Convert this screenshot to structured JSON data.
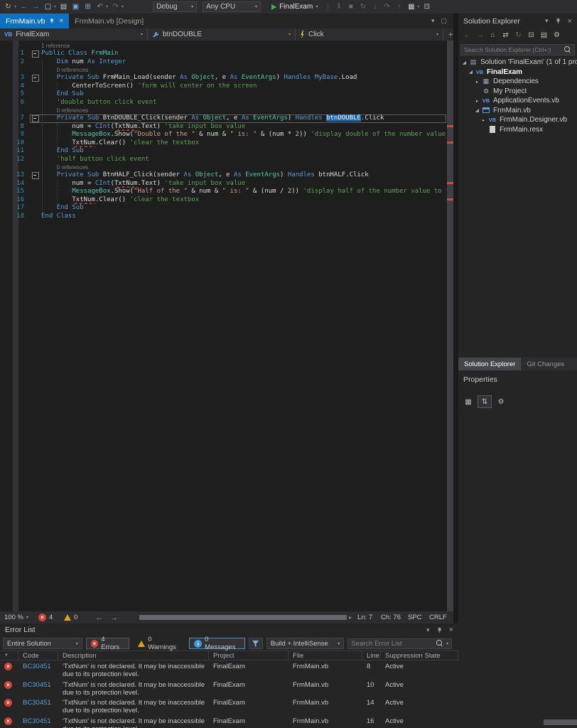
{
  "colors": {
    "accent_blue": "#0e70c0",
    "selection_blue": "#1c63b0",
    "error_red": "#d04437",
    "warning_yellow": "#d9a61a",
    "run_green": "#3cb63c",
    "keyword_blue": "#569cd6",
    "type_teal": "#4ec9b0",
    "string_orange": "#d69d85",
    "comment_green": "#57a64a",
    "line_number_teal": "#2b91af"
  },
  "top_toolbar": {
    "debug_combo": "Debug",
    "platform_combo": "Any CPU",
    "start_label": "FinalExam",
    "icons_left": [
      {
        "name": "hot-reload-icon",
        "glyph": "↻",
        "color": "#d8a657",
        "arrow": true
      },
      {
        "name": "nav-back-icon",
        "glyph": "←",
        "color": "#4b9fd6"
      },
      {
        "name": "nav-forward-icon",
        "glyph": "→",
        "color": "#4b9fd6"
      },
      {
        "name": "new-file-icon",
        "glyph": "▢",
        "color": "#c8c8c8",
        "arrow": true
      },
      {
        "name": "open-file-icon",
        "glyph": "▤",
        "color": "#c8c8c8"
      },
      {
        "name": "save-icon",
        "glyph": "▣",
        "color": "#7aa7d6"
      },
      {
        "name": "save-all-icon",
        "glyph": "⊞",
        "color": "#7aa7d6"
      },
      {
        "name": "undo-icon",
        "glyph": "↶",
        "color": "#4b9fd6",
        "arrow": true
      },
      {
        "name": "redo-icon",
        "glyph": "↷",
        "color": "#66696d",
        "arrow": true
      }
    ],
    "icons_right": [
      {
        "name": "pause-icon",
        "glyph": "‖",
        "color": "#66696d"
      },
      {
        "name": "stop-icon",
        "glyph": "■",
        "color": "#66696d"
      },
      {
        "name": "restart-icon",
        "glyph": "↻",
        "color": "#66696d"
      },
      {
        "name": "step-into-icon",
        "glyph": "↓",
        "color": "#66696d"
      },
      {
        "name": "step-over-icon",
        "glyph": "↷",
        "color": "#66696d"
      },
      {
        "name": "step-out-icon",
        "glyph": "↑",
        "color": "#66696d"
      },
      {
        "name": "watch-icon",
        "glyph": "▦",
        "color": "#c8c8c8",
        "arrow": true
      },
      {
        "name": "screenshot-icon",
        "glyph": "⊡",
        "color": "#c8c8c8"
      }
    ]
  },
  "doc_tabs": [
    {
      "label": "FrmMain.vb",
      "active": true
    },
    {
      "label": "FrmMain.vb [Design]",
      "active": false
    }
  ],
  "navbar": {
    "scope": "FinalExam",
    "member": "btnDOUBLE",
    "event": "Click"
  },
  "editor": {
    "rows": [
      {
        "kind": "lens",
        "pad": 0,
        "text": "1 reference"
      },
      {
        "kind": "code",
        "n": "1",
        "fold": true,
        "tokens": [
          [
            "kw",
            "Public"
          ],
          [
            "d",
            " "
          ],
          [
            "kw",
            "Class"
          ],
          [
            "d",
            " "
          ],
          [
            "ty",
            "FrmMain"
          ]
        ]
      },
      {
        "kind": "code",
        "n": "2",
        "tokens": [
          [
            "d",
            "    "
          ],
          [
            "kw",
            "Dim"
          ],
          [
            "d",
            " num "
          ],
          [
            "kw",
            "As"
          ],
          [
            "d",
            " "
          ],
          [
            "kw",
            "Integer"
          ]
        ]
      },
      {
        "kind": "lens",
        "pad": 4,
        "text": "0 references"
      },
      {
        "kind": "code",
        "n": "3",
        "fold": true,
        "tokens": [
          [
            "d",
            "    "
          ],
          [
            "kw",
            "Private"
          ],
          [
            "d",
            " "
          ],
          [
            "kw",
            "Sub"
          ],
          [
            "d",
            " FrmMain_Load(sender "
          ],
          [
            "kw",
            "As"
          ],
          [
            "d",
            " "
          ],
          [
            "ty",
            "Object"
          ],
          [
            "d",
            ", e "
          ],
          [
            "kw",
            "As"
          ],
          [
            "d",
            " "
          ],
          [
            "ty",
            "EventArgs"
          ],
          [
            "d",
            ") "
          ],
          [
            "kw",
            "Handles"
          ],
          [
            "d",
            " "
          ],
          [
            "kw",
            "MyBase"
          ],
          [
            "d",
            ".Load"
          ]
        ]
      },
      {
        "kind": "code",
        "n": "4",
        "tokens": [
          [
            "d",
            "        CenterToScreen() "
          ],
          [
            "cm",
            "'form will center on the screen"
          ]
        ]
      },
      {
        "kind": "code",
        "n": "5",
        "tokens": [
          [
            "d",
            "    "
          ],
          [
            "kw",
            "End Sub"
          ]
        ]
      },
      {
        "kind": "code",
        "n": "6",
        "tokens": [
          [
            "d",
            "    "
          ],
          [
            "cm",
            "'double button click event"
          ]
        ]
      },
      {
        "kind": "lens",
        "pad": 4,
        "text": "0 references"
      },
      {
        "kind": "code",
        "n": "7",
        "fold": true,
        "current": true,
        "tokens": [
          [
            "d",
            "    "
          ],
          [
            "kw",
            "Private"
          ],
          [
            "d",
            " "
          ],
          [
            "kw",
            "Sub"
          ],
          [
            "d",
            " BtnDOUBLE_Click(sender "
          ],
          [
            "kw",
            "As"
          ],
          [
            "d",
            " "
          ],
          [
            "ty",
            "Object"
          ],
          [
            "d",
            ", e "
          ],
          [
            "kw",
            "As"
          ],
          [
            "d",
            " "
          ],
          [
            "ty",
            "EventArgs"
          ],
          [
            "d",
            ") "
          ],
          [
            "kw",
            "Handles"
          ],
          [
            "d",
            " "
          ],
          [
            "sel",
            "btnDOUBLE"
          ],
          [
            "d",
            ".Click"
          ]
        ]
      },
      {
        "kind": "code",
        "n": "8",
        "tokens": [
          [
            "d",
            "        num = "
          ],
          [
            "kw",
            "CInt"
          ],
          [
            "d",
            "("
          ],
          [
            "err",
            "TxtNum"
          ],
          [
            "d",
            ".Text) "
          ],
          [
            "cm",
            "'take input box value"
          ]
        ]
      },
      {
        "kind": "code",
        "n": "9",
        "tokens": [
          [
            "d",
            "        "
          ],
          [
            "ty",
            "MessageBox"
          ],
          [
            "d",
            ".Show("
          ],
          [
            "st",
            "\"Double of the \""
          ],
          [
            "d",
            " & num & "
          ],
          [
            "st",
            "\" is: \""
          ],
          [
            "d",
            " & (num * "
          ],
          [
            "nm",
            "2"
          ],
          [
            "d",
            ")) "
          ],
          [
            "cm",
            "'display double of the number value t"
          ]
        ]
      },
      {
        "kind": "code",
        "n": "10",
        "tokens": [
          [
            "d",
            "        "
          ],
          [
            "err",
            "TxtNum"
          ],
          [
            "d",
            ".Clear() "
          ],
          [
            "cm",
            "'clear the textbox"
          ]
        ]
      },
      {
        "kind": "code",
        "n": "11",
        "tokens": [
          [
            "d",
            "    "
          ],
          [
            "kw",
            "End Sub"
          ]
        ]
      },
      {
        "kind": "code",
        "n": "12",
        "tokens": [
          [
            "d",
            "    "
          ],
          [
            "cm",
            "'half button click event"
          ]
        ]
      },
      {
        "kind": "lens",
        "pad": 4,
        "text": "0 references"
      },
      {
        "kind": "code",
        "n": "13",
        "fold": true,
        "tokens": [
          [
            "d",
            "    "
          ],
          [
            "kw",
            "Private"
          ],
          [
            "d",
            " "
          ],
          [
            "kw",
            "Sub"
          ],
          [
            "d",
            " BtnHALF_Click(sender "
          ],
          [
            "kw",
            "As"
          ],
          [
            "d",
            " "
          ],
          [
            "ty",
            "Object"
          ],
          [
            "d",
            ", e "
          ],
          [
            "kw",
            "As"
          ],
          [
            "d",
            " "
          ],
          [
            "ty",
            "EventArgs"
          ],
          [
            "d",
            ") "
          ],
          [
            "kw",
            "Handles"
          ],
          [
            "d",
            " btnHALF.Click"
          ]
        ]
      },
      {
        "kind": "code",
        "n": "14",
        "tokens": [
          [
            "d",
            "        num = "
          ],
          [
            "kw",
            "CInt"
          ],
          [
            "d",
            "("
          ],
          [
            "err",
            "TxtNum"
          ],
          [
            "d",
            ".Text) "
          ],
          [
            "cm",
            "'take input box value"
          ]
        ]
      },
      {
        "kind": "code",
        "n": "15",
        "tokens": [
          [
            "d",
            "        "
          ],
          [
            "ty",
            "MessageBox"
          ],
          [
            "d",
            ".Show("
          ],
          [
            "st",
            "\"Half of the \""
          ],
          [
            "d",
            " & num & "
          ],
          [
            "st",
            "\" is: \""
          ],
          [
            "d",
            " & (num / "
          ],
          [
            "nm",
            "2"
          ],
          [
            "d",
            ")) "
          ],
          [
            "cm",
            "'display half of the number value to th"
          ]
        ]
      },
      {
        "kind": "code",
        "n": "16",
        "tokens": [
          [
            "d",
            "        "
          ],
          [
            "err",
            "TxtNum"
          ],
          [
            "d",
            ".Clear() "
          ],
          [
            "cm",
            "'clear the textbox"
          ]
        ]
      },
      {
        "kind": "code",
        "n": "17",
        "tokens": [
          [
            "d",
            "    "
          ],
          [
            "kw",
            "End Sub"
          ]
        ]
      },
      {
        "kind": "code",
        "n": "18",
        "tokens": [
          [
            "kw",
            "End Class"
          ]
        ]
      }
    ]
  },
  "status_strip": {
    "zoom": "100 %",
    "error_count": "4",
    "warning_count": "0",
    "line": "Ln: 7",
    "column": "Ch: 76",
    "spaces": "SPC",
    "line_ending": "CRLF"
  },
  "solution_explorer": {
    "title": "Solution Explorer",
    "search_placeholder": "Search Solution Explorer (Ctrl+;)",
    "toolbar_icons": [
      {
        "name": "se-back-icon",
        "glyph": "←",
        "dim": true
      },
      {
        "name": "se-forward-icon",
        "glyph": "→",
        "dim": true
      },
      {
        "name": "se-home-icon",
        "glyph": "⌂"
      },
      {
        "name": "se-switch-views-icon",
        "glyph": "⇄"
      },
      {
        "name": "se-refresh-icon",
        "glyph": "↻",
        "dim": true
      },
      {
        "name": "se-collapse-all-icon",
        "glyph": "⊟"
      },
      {
        "name": "se-show-all-files-icon",
        "glyph": "▤"
      },
      {
        "name": "se-properties-icon",
        "glyph": "⚙"
      }
    ],
    "tree": [
      {
        "name": "solution",
        "icon": "solution",
        "arrow": "expanded",
        "indent": 0,
        "label": "Solution 'FinalExam' (1 of 1 project)"
      },
      {
        "name": "project-finalexam",
        "icon": "vb-project",
        "arrow": "expanded",
        "indent": 1,
        "label": "FinalExam",
        "bold": true
      },
      {
        "name": "dependencies",
        "icon": "dependencies",
        "arrow": "collapsed",
        "indent": 2,
        "label": "Dependencies"
      },
      {
        "name": "my-project",
        "icon": "my-project",
        "arrow": "none",
        "indent": 2,
        "label": "My Project"
      },
      {
        "name": "applicationevents-vb",
        "icon": "vb-file",
        "arrow": "collapsed",
        "indent": 2,
        "label": "ApplicationEvents.vb"
      },
      {
        "name": "frmmain-vb",
        "icon": "form",
        "arrow": "expanded",
        "indent": 2,
        "label": "FrmMain.vb"
      },
      {
        "name": "frmmain-designer-vb",
        "icon": "vb-file",
        "arrow": "collapsed",
        "indent": 3,
        "label": "FrmMain.Designer.vb"
      },
      {
        "name": "frmmain-resx",
        "icon": "resx",
        "arrow": "none",
        "indent": 3,
        "label": "FrmMain.resx"
      }
    ]
  },
  "panel_tabs": [
    {
      "label": "Solution Explorer",
      "active": true
    },
    {
      "label": "Git Changes",
      "active": false
    }
  ],
  "properties_panel": {
    "title": "Properties",
    "toolbar_icons": [
      {
        "name": "props-categorized-icon",
        "glyph": "▦"
      },
      {
        "name": "props-alphabetical-icon",
        "glyph": "⇅",
        "boxed": true
      },
      {
        "name": "props-pages-icon",
        "glyph": "⚙"
      }
    ]
  },
  "error_list": {
    "title": "Error List",
    "scope_combo": "Entire Solution",
    "errors_button": "4 Errors",
    "warnings_button": "0 Warnings",
    "messages_button": "0 Messages",
    "source_combo": "Build + IntelliSense",
    "search_placeholder": "Search Error List",
    "columns": [
      "Code",
      "Description",
      "Project",
      "File",
      "Line",
      "Suppression State"
    ],
    "rows": [
      {
        "code": "BC30451",
        "desc1": "'TxtNum' is not declared. It may be inaccessible",
        "desc2": "due to its protection level.",
        "project": "FinalExam",
        "file": "FrmMain.vb",
        "line": "8",
        "state": "Active"
      },
      {
        "code": "BC30451",
        "desc1": "'TxtNum' is not declared. It may be inaccessible",
        "desc2": "due to its protection level.",
        "project": "FinalExam",
        "file": "FrmMain.vb",
        "line": "10",
        "state": "Active"
      },
      {
        "code": "BC30451",
        "desc1": "'TxtNum' is not declared. It may be inaccessible",
        "desc2": "due to its protection level.",
        "project": "FinalExam",
        "file": "FrmMain.vb",
        "line": "14",
        "state": "Active"
      },
      {
        "code": "BC30451",
        "desc1": "'TxtNum' is not declared. It may be inaccessible",
        "desc2": "due to its protection level.",
        "project": "FinalExam",
        "file": "FrmMain.vb",
        "line": "16",
        "state": "Active"
      }
    ]
  }
}
